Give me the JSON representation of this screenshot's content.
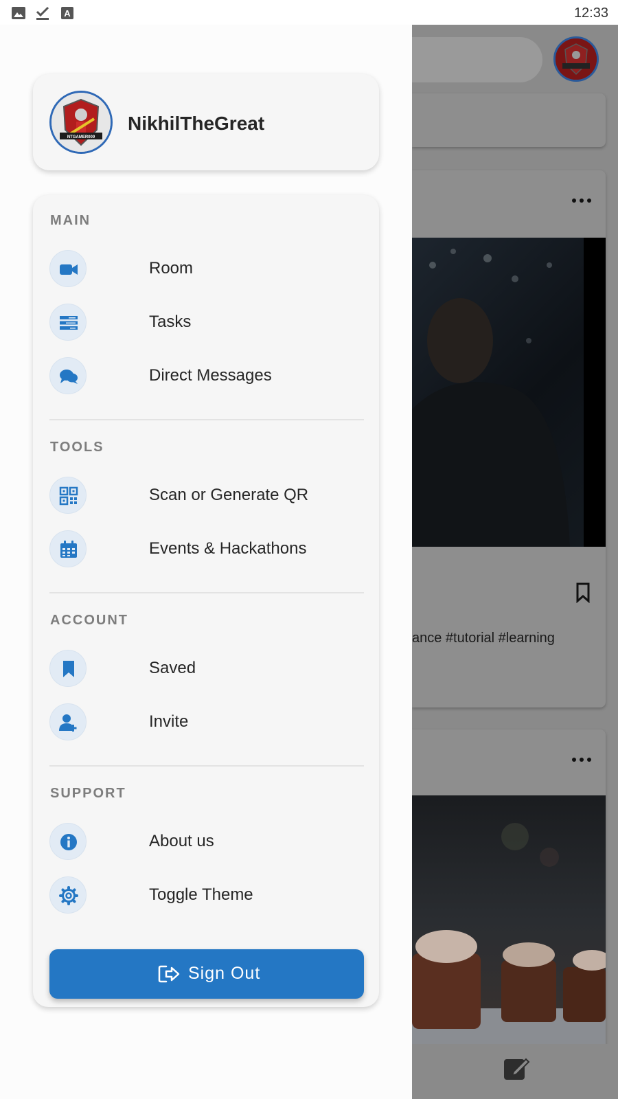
{
  "status_bar": {
    "time": "12:33",
    "icons": [
      "image-icon",
      "check-download-icon",
      "text-a-icon"
    ]
  },
  "profile": {
    "username": "NikhilTheGreat",
    "avatar_badge_text": "NTGAMER009"
  },
  "sections": [
    {
      "title": "MAIN",
      "items": [
        {
          "label": "Room",
          "icon": "video-camera-icon"
        },
        {
          "label": "Tasks",
          "icon": "tasks-list-icon"
        },
        {
          "label": "Direct Messages",
          "icon": "chat-bubbles-icon"
        }
      ]
    },
    {
      "title": "TOOLS",
      "items": [
        {
          "label": "Scan or Generate QR",
          "icon": "qr-code-icon"
        },
        {
          "label": "Events & Hackathons",
          "icon": "calendar-icon"
        }
      ]
    },
    {
      "title": "ACCOUNT",
      "items": [
        {
          "label": "Saved",
          "icon": "bookmark-icon"
        },
        {
          "label": "Invite",
          "icon": "add-user-icon"
        }
      ]
    },
    {
      "title": "SUPPORT",
      "items": [
        {
          "label": "About us",
          "icon": "info-icon"
        },
        {
          "label": "Toggle Theme",
          "icon": "gear-icon"
        }
      ]
    }
  ],
  "sign_out": {
    "label": "Sign Out",
    "icon": "sign-out-icon"
  },
  "background_feed": {
    "post_text_fragment": "ance #tutorial #learning"
  },
  "colors": {
    "accent": "#2477c4",
    "icon_bg": "#e2ebf5",
    "section_title": "#7d7d7d",
    "drawer_bg": "#fcfcfc",
    "card_bg": "#f6f6f6"
  }
}
